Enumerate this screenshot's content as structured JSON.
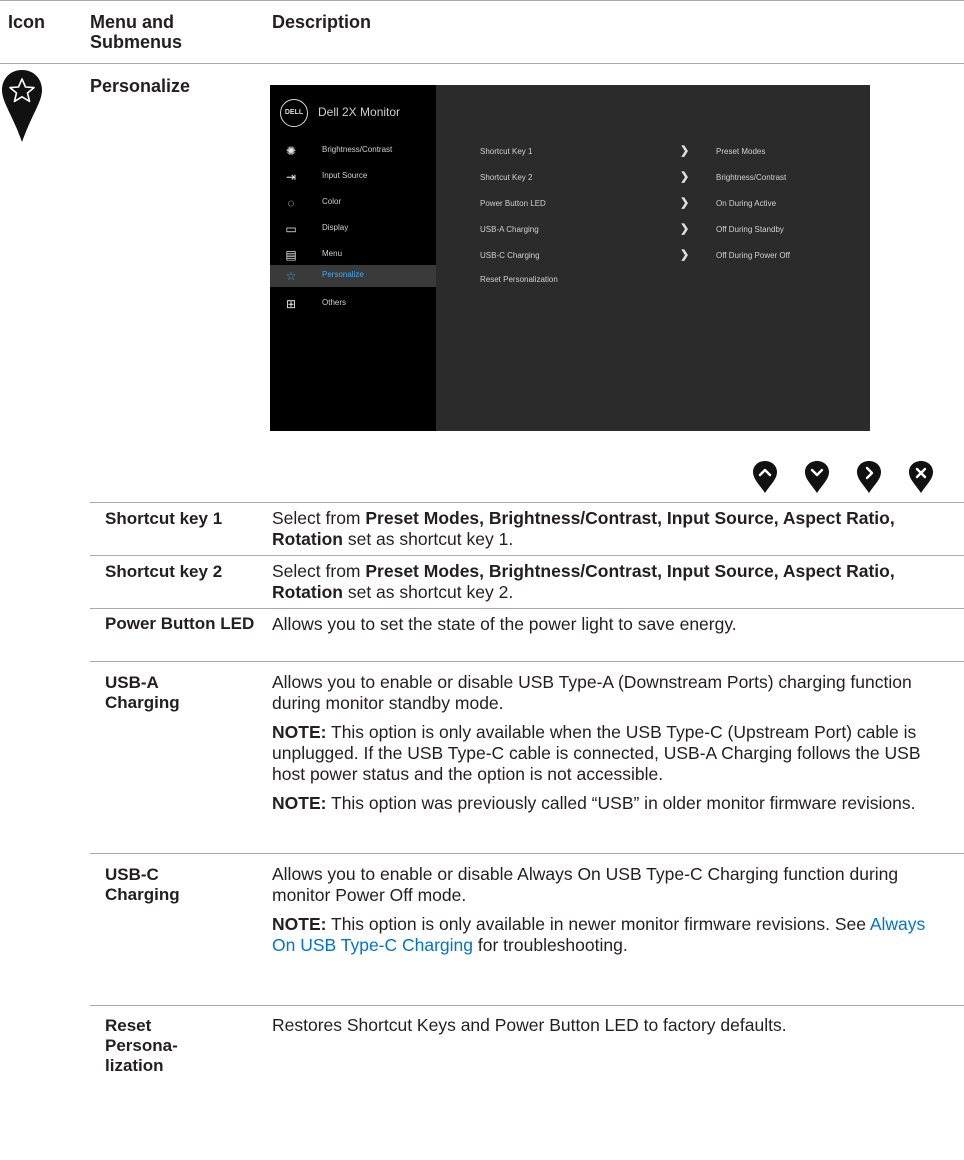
{
  "header": {
    "icon": "Icon",
    "menu": "Menu and Submenus",
    "description": "Description"
  },
  "section": {
    "title": "Personalize",
    "icon": "star-icon"
  },
  "osd": {
    "brand": "DELL",
    "title": "Dell 2X Monitor",
    "menu": [
      {
        "label": "Brightness/Contrast",
        "icon": "brightness-icon"
      },
      {
        "label": "Input Source",
        "icon": "input-source-icon"
      },
      {
        "label": "Color",
        "icon": "color-palette-icon"
      },
      {
        "label": "Display",
        "icon": "display-icon"
      },
      {
        "label": "Menu",
        "icon": "menu-icon"
      },
      {
        "label": "Personalize",
        "icon": "star-icon"
      },
      {
        "label": "Others",
        "icon": "others-icon"
      }
    ],
    "submenu": [
      {
        "label": "Shortcut Key 1",
        "value": "Preset Modes"
      },
      {
        "label": "Shortcut Key 2",
        "value": "Brightness/Contrast"
      },
      {
        "label": "Power Button LED",
        "value": "On During Active"
      },
      {
        "label": "USB-A Charging",
        "value": "Off During Standby"
      },
      {
        "label": "USB-C Charging",
        "value": "Off During Power Off"
      },
      {
        "label": "Reset Personalization",
        "value": ""
      }
    ]
  },
  "nav_buttons": [
    "up-icon",
    "down-icon",
    "right-icon",
    "close-icon"
  ],
  "rows": [
    {
      "label": "Shortcut key 1",
      "pre": "Select from ",
      "bold": "Preset Modes, Brightness/Contrast, Input Source, Aspect Ratio, Rotation",
      "post": " set as shortcut key 1."
    },
    {
      "label": "Shortcut key 2",
      "pre": "Select from ",
      "bold": "Preset Modes, Brightness/Contrast, Input Source, Aspect Ratio, Rotation",
      "post": " set as shortcut key 2."
    },
    {
      "label": "Power Button LED",
      "text": "Allows you to set the state of the power light to save energy."
    },
    {
      "label": "USB-A Charging",
      "text": "Allows you to enable or disable USB Type-A (Downstream Ports) charging function during monitor standby mode.",
      "note1_label": "NOTE:",
      "note1": " This option is only available when the USB Type-C (Upstream Port) cable is unplugged. If the USB Type-C cable is connected, USB-A Charging follows the USB host power status and the option is not accessible.",
      "note2_label": "NOTE:",
      "note2": " This option was previously called “USB” in older monitor firmware revisions."
    },
    {
      "label": "USB-C Charging",
      "text": "Allows you to enable or disable Always On USB Type-C Charging function during monitor Power Off mode.",
      "note1_label": "NOTE:",
      "note1_pre": " This option is only available in newer monitor firmware revisions.  See ",
      "note1_link": "Always On USB Type-C Charging",
      "note1_post": " for troubleshooting."
    },
    {
      "label": "Reset Persona-lization",
      "text": "Restores Shortcut Keys and Power Button LED to factory defaults."
    }
  ],
  "colors": {
    "link": "#0073cf",
    "osd_selected": "#3fa9f5",
    "rule": "#a7a9ac"
  }
}
